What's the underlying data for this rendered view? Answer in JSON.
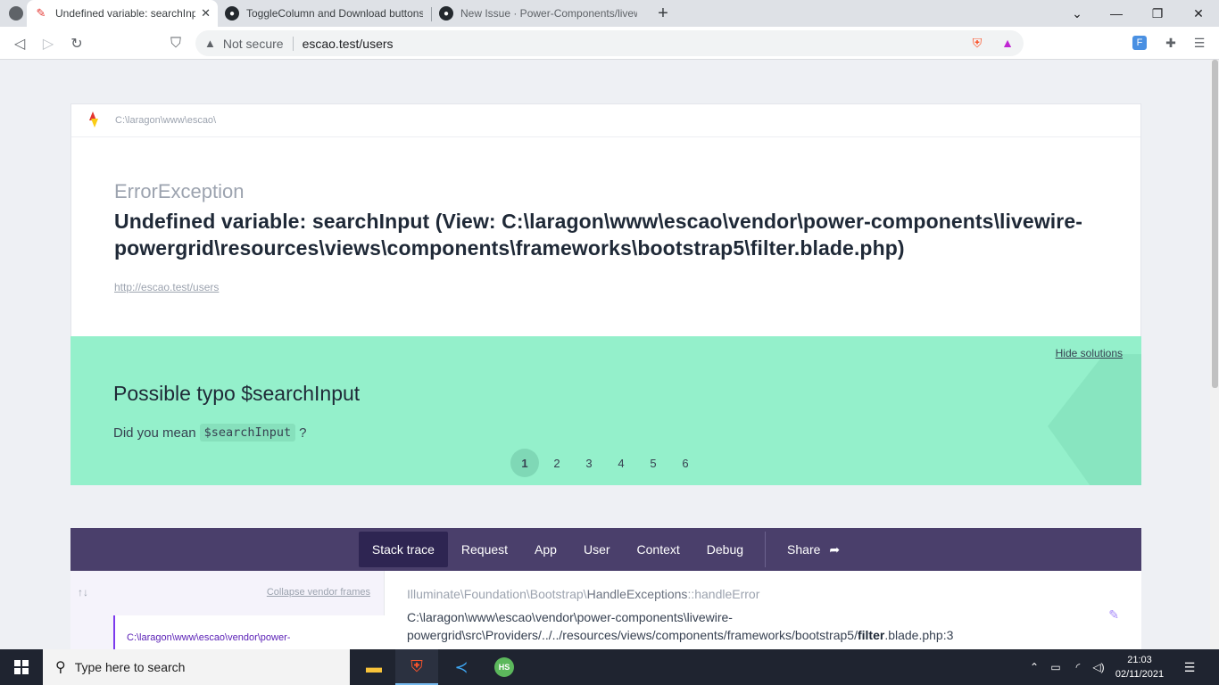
{
  "browser": {
    "tabs": [
      {
        "title": "Undefined variable: searchInput",
        "active": true,
        "icon": "broken-pencil-icon"
      },
      {
        "title": "ToggleColumn and Download buttons",
        "active": false,
        "icon": "github-icon"
      },
      {
        "title": "New Issue · Power-Components/livewire",
        "active": false,
        "icon": "github-icon"
      }
    ],
    "new_tab": "+",
    "security_label": "Not secure",
    "url": "escao.test/users"
  },
  "error": {
    "path": "C:\\laragon\\www\\escao\\",
    "class": "ErrorException",
    "message": "Undefined variable: searchInput (View: C:\\laragon\\www\\escao\\vendor\\power-components\\livewire-powergrid\\resources\\views\\components\\frameworks\\bootstrap5\\filter.blade.php)",
    "url": "http://escao.test/users"
  },
  "solution": {
    "hide_label": "Hide solutions",
    "title": "Possible typo $searchInput",
    "text_before": "Did you mean",
    "code": "$searchInput",
    "text_after": "?",
    "pages": [
      "1",
      "2",
      "3",
      "4",
      "5",
      "6"
    ],
    "current_page": "1"
  },
  "nav": {
    "tabs": [
      "Stack trace",
      "Request",
      "App",
      "User",
      "Context",
      "Debug"
    ],
    "active": "Stack trace",
    "share": "Share"
  },
  "stack": {
    "arrows": "↑↓",
    "collapse_label": "Collapse vendor frames",
    "frame_preview": "C:\\laragon\\www\\escao\\vendor\\power-",
    "class_path": "Illuminate\\Foundation\\Bootstrap\\",
    "class_name": "HandleExceptions",
    "method": "::handleError",
    "file_prefix": "C:\\laragon\\www\\escao\\vendor\\power-components\\livewire-powergrid\\src\\Providers/../../resources/views/",
    "file_dir": "components/frameworks/bootstrap5/",
    "file_name": "filter",
    "file_suffix": ".blade.php:3"
  },
  "taskbar": {
    "search_placeholder": "Type here to search",
    "time": "21:03",
    "date": "02/11/2021"
  }
}
